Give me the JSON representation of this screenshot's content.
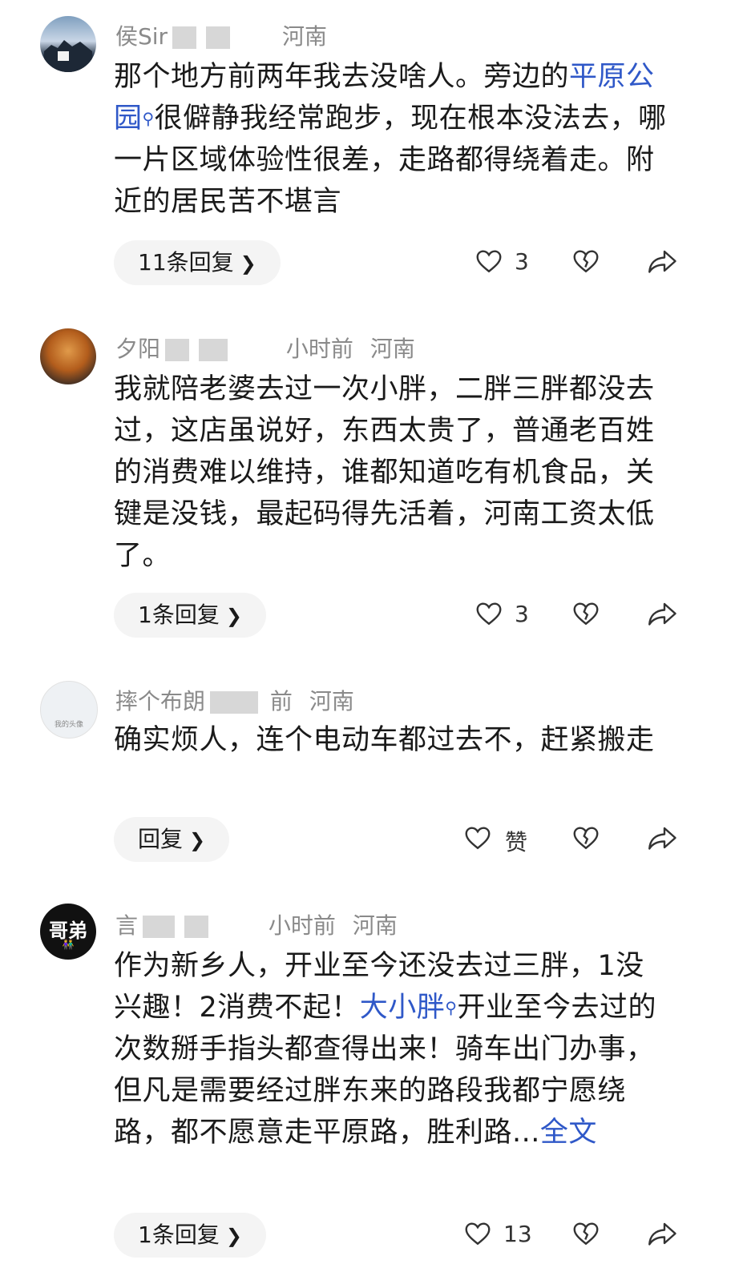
{
  "comments": [
    {
      "username": "侯Sir",
      "time": "",
      "location": "河南",
      "text_before": "那个地方前两年我去没啥人。旁边的",
      "link": "平原公园",
      "text_after": "很僻静我经常跑步，现在根本没法去，哪一片区域体验性很差，走路都得绕着走。附近的居民苦不堪言",
      "replies": "11条回复",
      "likes": "3"
    },
    {
      "username": "夕阳",
      "time": "小时前",
      "location": "河南",
      "text": "我就陪老婆去过一次小胖，二胖三胖都没去过，这店虽说好，东西太贵了，普通老百姓的消费难以维持，谁都知道吃有机食品，关键是没钱，最起码得先活着，河南工资太低了。",
      "replies": "1条回复",
      "likes": "3"
    },
    {
      "username": "摔个布朗",
      "time": "前",
      "location": "河南",
      "avatar_text": "我的头像",
      "text": "确实烦人，连个电动车都过去不，赶紧搬走",
      "replies": "回复",
      "likes": "赞"
    },
    {
      "username": "言",
      "avatar_text": "哥弟",
      "time": "小时前",
      "location": "河南",
      "text_before": "作为新乡人，开业至今还没去过三胖，1没兴趣！2消费不起！",
      "link": "大小胖",
      "text_after": "开业至今去过的次数掰手指头都查得出来！骑车出门办事，但凡是需要经过胖东来的路段我都宁愿绕路，都不愿意走平原路，胜利路...",
      "full_text": "全文",
      "replies": "1条回复",
      "likes": "13"
    }
  ],
  "icons": {
    "search_mark": "search-icon",
    "chevron": "›"
  },
  "colors": {
    "link": "#2f58c8",
    "meta": "#8a8a8a",
    "text": "#1a1a1a",
    "pill": "#f4f4f4"
  }
}
